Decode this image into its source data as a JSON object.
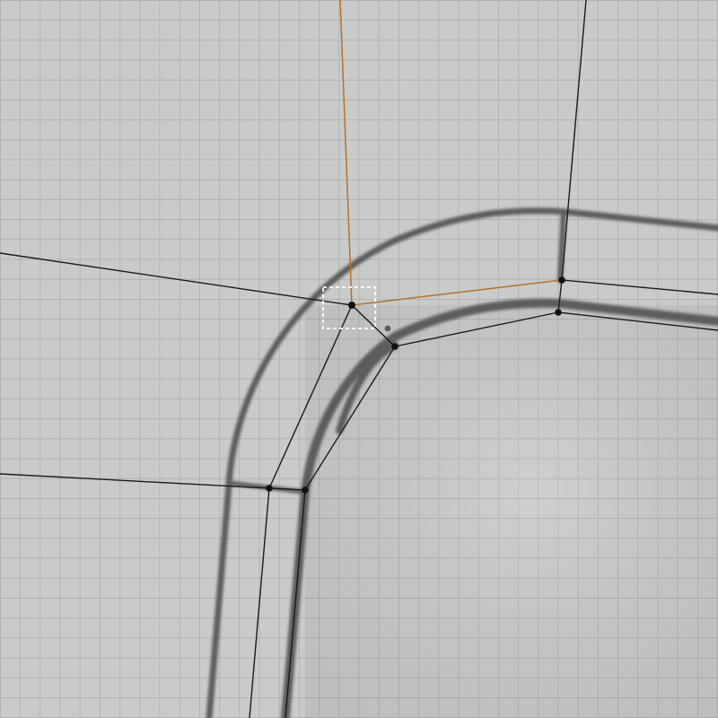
{
  "viewport": {
    "background_color": "#c9cbca",
    "grid_color": "#a9aba9",
    "trace_color": "#5c5d5d",
    "edge_color": "#1a1a1a",
    "selected_edge_color": "#b5712a",
    "vertex_color": "#111111",
    "selection_box_color": "#ffffff"
  }
}
